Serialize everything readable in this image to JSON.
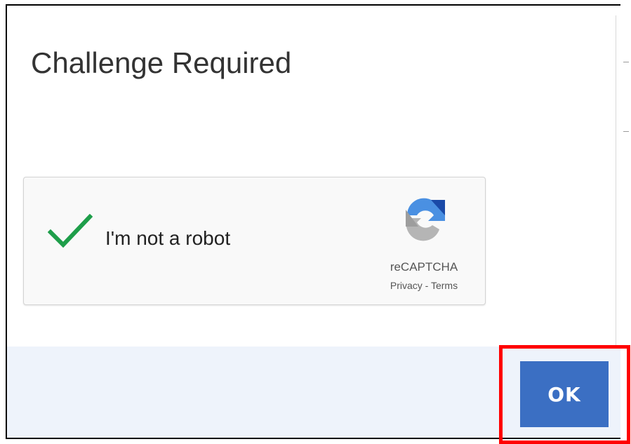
{
  "dialog": {
    "title": "Challenge Required"
  },
  "captcha": {
    "label": "I'm not a robot",
    "checked": true,
    "brand": "reCAPTCHA",
    "privacy_label": "Privacy",
    "separator": " - ",
    "terms_label": "Terms",
    "check_color": "#1e9e4a",
    "icon": "recaptcha-logo-icon"
  },
  "footer": {
    "ok_label": "OK",
    "ok_color": "#3b6fc3",
    "highlight_color": "#ff0000"
  }
}
